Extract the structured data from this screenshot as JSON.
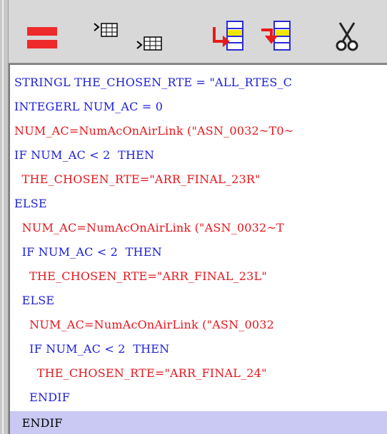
{
  "toolbar": {
    "buttons": [
      {
        "name": "equals",
        "icon": "equals-icon"
      },
      {
        "name": "indent-table",
        "icon": "indent-table-icon"
      },
      {
        "name": "outdent-table",
        "icon": "outdent-table-icon"
      },
      {
        "name": "move-right",
        "icon": "move-right-icon"
      },
      {
        "name": "move-down",
        "icon": "move-down-icon"
      },
      {
        "name": "cut",
        "icon": "scissors-icon"
      }
    ]
  },
  "code": {
    "lines": [
      {
        "text": "STRINGL THE_CHOSEN_RTE = \"ALL_RTES_C",
        "color": "blue"
      },
      {
        "text": "INTEGERL NUM_AC = 0",
        "color": "blue"
      },
      {
        "text": "NUM_AC=NumAcOnAirLink (\"ASN_0032~T0~",
        "color": "red"
      },
      {
        "text": "IF NUM_AC < 2  THEN",
        "color": "blue"
      },
      {
        "text": "  THE_CHOSEN_RTE=\"ARR_FINAL_23R\"",
        "color": "red"
      },
      {
        "text": "ELSE",
        "color": "blue"
      },
      {
        "text": "  NUM_AC=NumAcOnAirLink (\"ASN_0032~T",
        "color": "red"
      },
      {
        "text": "  IF NUM_AC < 2  THEN",
        "color": "blue"
      },
      {
        "text": "    THE_CHOSEN_RTE=\"ARR_FINAL_23L\"",
        "color": "red"
      },
      {
        "text": "  ELSE",
        "color": "blue"
      },
      {
        "text": "    NUM_AC=NumAcOnAirLink (\"ASN_0032",
        "color": "red"
      },
      {
        "text": "    IF NUM_AC < 2  THEN",
        "color": "blue"
      },
      {
        "text": "      THE_CHOSEN_RTE=\"ARR_FINAL_24\"",
        "color": "red"
      },
      {
        "text": "    ENDIF",
        "color": "blue"
      },
      {
        "text": "  ENDIF",
        "color": "black",
        "highlighted": true
      }
    ]
  },
  "colors": {
    "keyword": "#1e20d8",
    "string": "#e6161c",
    "highlight": "#c9c9f4"
  }
}
